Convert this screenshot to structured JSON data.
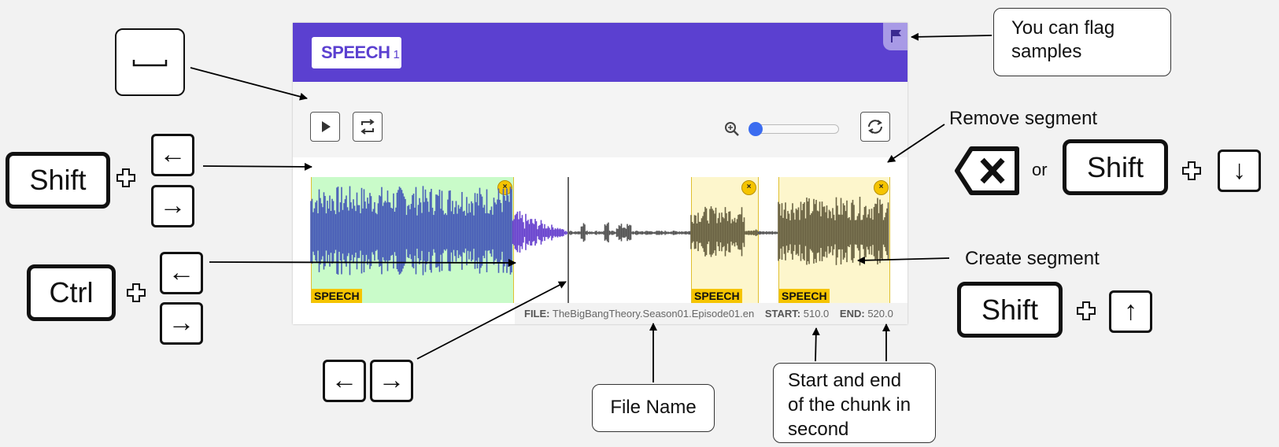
{
  "card": {
    "label_badge": "SPEECH",
    "label_count": "1",
    "segments": [
      {
        "label": "SPEECH",
        "close": "×",
        "color": "#c9fbc9"
      },
      {
        "label": "SPEECH",
        "close": "×",
        "color": "#fdf6cc"
      },
      {
        "label": "SPEECH",
        "close": "×",
        "color": "#fdf6cc"
      }
    ],
    "footer": {
      "file_key": "FILE:",
      "file_val": "TheBigBangTheory.Season01.Episode01.en",
      "start_key": "START:",
      "start_val": "510.0",
      "end_key": "END:",
      "end_val": "520.0"
    },
    "zoom_level": 0.0,
    "colors": {
      "header": "#5b40d0",
      "slider": "#3b6cf0"
    }
  },
  "annotations": {
    "flag_note": [
      "You can flag",
      "samples"
    ],
    "remove_segment": "Remove segment",
    "or_text": "or",
    "create_segment": "Create  segment",
    "file_name": "File Name",
    "start_end_note": [
      "Start and end",
      "of the chunk in",
      "second"
    ]
  },
  "keys": {
    "shift": "Shift",
    "ctrl": "Ctrl",
    "space_icon": "space-bar-icon",
    "left_arrow": "←",
    "right_arrow": "→",
    "up_arrow": "↑",
    "down_arrow": "↓",
    "backspace_icon": "backspace-icon",
    "plus_icon": "plus-outline-icon"
  }
}
